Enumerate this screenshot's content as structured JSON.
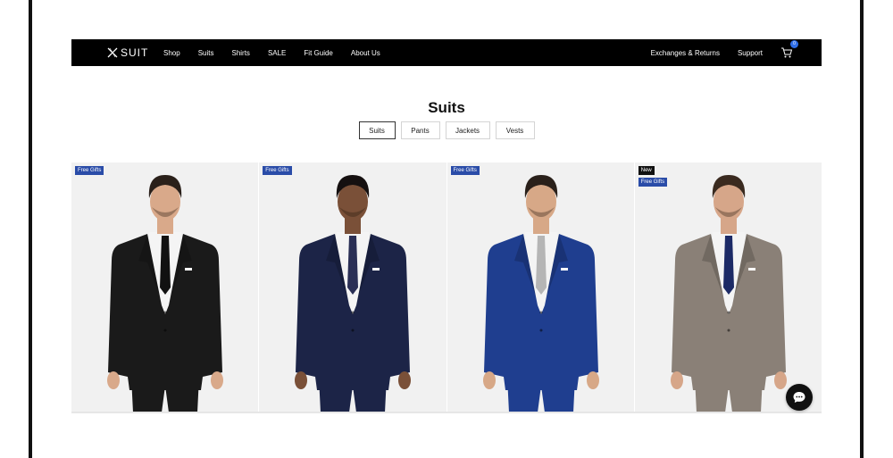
{
  "brand": {
    "name": "SUIT",
    "logo_icon": "x-mark-icon"
  },
  "nav": {
    "left": [
      "Shop",
      "Suits",
      "Shirts",
      "SALE",
      "Fit Guide",
      "About Us"
    ],
    "right": [
      "Exchanges & Returns",
      "Support"
    ],
    "cart_count": "0",
    "cart_icon": "cart-icon"
  },
  "page": {
    "title": "Suits"
  },
  "tabs": [
    {
      "label": "Suits",
      "active": true
    },
    {
      "label": "Pants",
      "active": false
    },
    {
      "label": "Jackets",
      "active": false
    },
    {
      "label": "Vests",
      "active": false
    }
  ],
  "products": [
    {
      "badges": [
        "Free Gifts"
      ],
      "suit_color": "#1a1a1a",
      "tie_color": "#111111",
      "skin": "#d9a98a",
      "hair": "#2a201a"
    },
    {
      "badges": [
        "Free Gifts"
      ],
      "suit_color": "#1c2447",
      "tie_color": "#2a2f55",
      "skin": "#7a5038",
      "hair": "#151010"
    },
    {
      "badges": [
        "Free Gifts"
      ],
      "suit_color": "#1f3e8f",
      "tie_color": "#b5b5b5",
      "skin": "#d7a887",
      "hair": "#2a201a"
    },
    {
      "badges": [
        "New",
        "Free Gifts"
      ],
      "suit_color": "#8a8077",
      "tie_color": "#1c2a66",
      "skin": "#d6a689",
      "hair": "#3a2a1f"
    }
  ],
  "carousel_progress": 0.0,
  "colors": {
    "navbar": "#000000",
    "badge_gift": "#2a4ca8",
    "badge_new": "#111111",
    "cart_badge": "#2f6ee8"
  },
  "chat": {
    "icon": "chat-bubble-icon"
  }
}
